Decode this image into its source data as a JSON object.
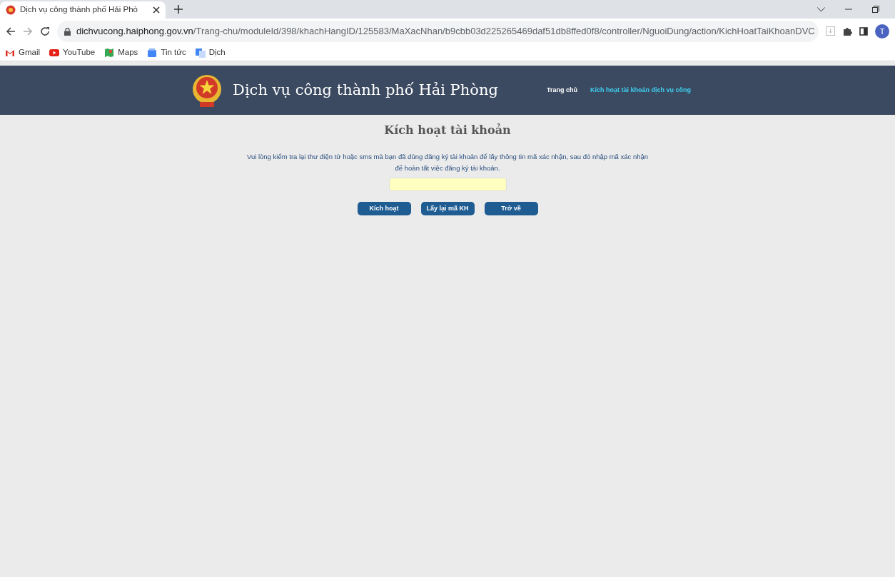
{
  "browser": {
    "tab_title": "Dịch vụ công thành phố Hải Phò",
    "url_host": "dichvucong.haiphong.gov.vn",
    "url_path": "/Trang-chu/moduleId/398/khachHangID/125583/MaXacNhan/b9cbb03d225265469daf51db8ffed0f8/controller/NguoiDung/action/KichHoatTaiKhoanDVC",
    "profile_initial": "T",
    "bookmarks": [
      {
        "label": "Gmail",
        "kind": "gmail"
      },
      {
        "label": "YouTube",
        "kind": "youtube"
      },
      {
        "label": "Maps",
        "kind": "maps"
      },
      {
        "label": "Tin tức",
        "kind": "news"
      },
      {
        "label": "Dịch",
        "kind": "translate"
      }
    ]
  },
  "header": {
    "site_title": "Dịch vụ công thành phố Hải Phòng",
    "nav": [
      {
        "label": "Trang chủ",
        "selected": false
      },
      {
        "label": "Kích hoạt tài khoản dịch vụ công",
        "selected": true
      }
    ]
  },
  "form": {
    "title": "Kích hoạt tài khoản",
    "instruction_line1": "Vui lòng kiểm tra lại thư điện tử hoặc sms mà bạn đã dùng đăng ký tài khoản để lấy thông tin mã xác nhận, sau đó nhập mã xác nhận",
    "instruction_line2": "để hoàn tất việc đăng ký tài khoản.",
    "buttons": [
      "Kích hoạt",
      "Lấy lại mã KH",
      "Trở về"
    ]
  }
}
